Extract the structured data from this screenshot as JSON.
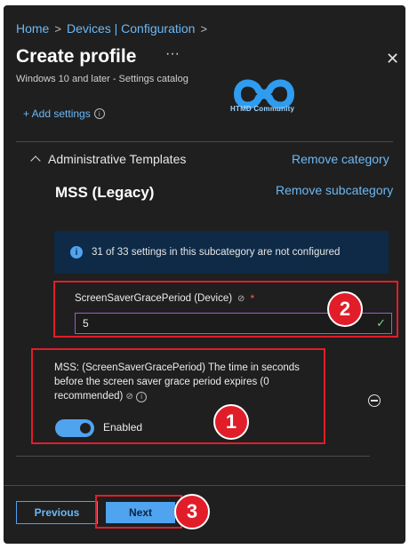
{
  "breadcrumb": {
    "home": "Home",
    "sep": ">",
    "devices": "Devices | Configuration"
  },
  "header": {
    "title": "Create profile",
    "ellipsis": "···",
    "subtitle": "Windows 10 and later - Settings catalog",
    "close_icon": "close-icon"
  },
  "logo": {
    "text": "HTMD Community",
    "primary_color": "#2f9cf0"
  },
  "add_settings": {
    "label": "+ Add settings"
  },
  "category": {
    "name": "Administrative Templates",
    "remove_label": "Remove category",
    "subcategory": "MSS (Legacy)",
    "remove_sub_label": "Remove subcategory"
  },
  "info_bar": {
    "text": "31 of 33 settings in this subcategory are not configured"
  },
  "setting1": {
    "label": "ScreenSaverGracePeriod (Device)",
    "required_mark": "*",
    "value": "5"
  },
  "setting2": {
    "description": "MSS: (ScreenSaverGracePeriod) The time in seconds before the screen saver grace period expires (0 recommended)",
    "toggle_label": "Enabled"
  },
  "badges": {
    "one": "1",
    "two": "2",
    "three": "3"
  },
  "footer": {
    "previous_label": "Previous",
    "next_label": "Next"
  },
  "colors": {
    "accent": "#4fa3ef",
    "highlight": "#e11d2a",
    "panel_bg": "#1f1f1f"
  }
}
